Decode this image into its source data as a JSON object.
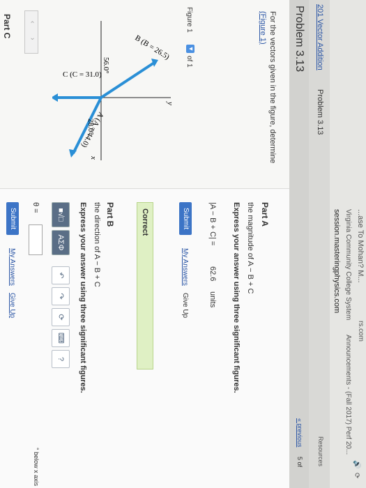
{
  "browser": {
    "tab_partial": "rs.com",
    "tab_title_partial": "...ase To Mohan? M...",
    "company": "Virginia Community College System",
    "announcements": "Announcements - (Fall 2017) Perf 20...",
    "url": "session.masteringphysics.com",
    "resources": "Resources",
    "icons_right": [
      "speaker-icon",
      "refresh-icon"
    ]
  },
  "breadcrumb": {
    "link": "201 Vector Addition",
    "current": "Problem 3.13"
  },
  "problem": {
    "title": "Problem 3.13",
    "prompt": "For the vectors given in the figure, determine",
    "figure_link": "(Figure 1)",
    "figure_label": "Figure 1",
    "figure_counter": "of 1",
    "previous_label": "« previous",
    "page_count": "5 of"
  },
  "figure": {
    "labels": {
      "B": "B (B = 26.5)",
      "A": "A (A = 44.0)",
      "C": "C (C = 31.0)",
      "angle_left": "56.0°",
      "angle_right": "28.0°",
      "x_axis": "x",
      "y_axis": "y"
    }
  },
  "partA": {
    "heading": "Part A",
    "question": "the magnitude of A − B + C",
    "instruction": "Express your answer using three significant figures.",
    "expression": "|A − B + C| =",
    "value": "62.6",
    "unit": "units",
    "submit": "Submit",
    "my_answers": "My Answers",
    "give_up": "Give Up",
    "correct": "Correct"
  },
  "partB": {
    "heading": "Part B",
    "question": "the direction of A − B + C",
    "instruction": "Express your answer using three significant figures.",
    "theta": "θ =",
    "suffix": "° below x axis",
    "submit": "Submit",
    "my_answers": "My Answers",
    "give_up": "Give Up",
    "tools": [
      "■√□",
      "AΣΦ",
      "↶",
      "↷",
      "⟳",
      "⌨",
      "?"
    ]
  },
  "partC": {
    "heading": "Part C"
  },
  "colors": {
    "vector": "#2a8fd6",
    "correct_bg": "#dff0c4",
    "button": "#3c74c6"
  }
}
